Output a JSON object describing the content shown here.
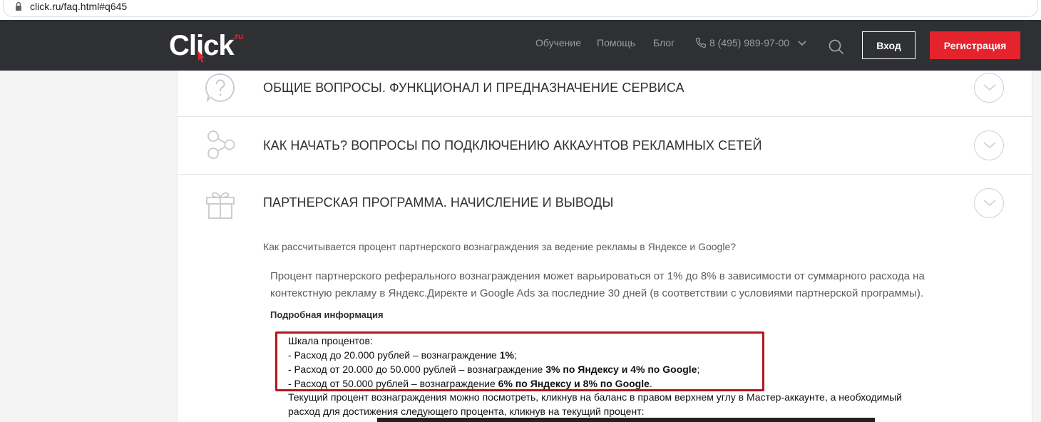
{
  "browser": {
    "url": "click.ru/faq.html#q645"
  },
  "header": {
    "logo_text": "Click",
    "logo_sup": ".ru",
    "nav": [
      "Обучение",
      "Помощь",
      "Блог"
    ],
    "phone": "8 (495) 989-97-00",
    "login_label": "Вход",
    "register_label": "Регистрация",
    "brand_color": "#e4232d"
  },
  "sections": [
    {
      "title": "ОБЩИЕ ВОПРОСЫ. ФУНКЦИОНАЛ И ПРЕДНАЗНАЧЕНИЕ СЕРВИСА",
      "icon": "question-circle-icon"
    },
    {
      "title": "КАК НАЧАТЬ? ВОПРОСЫ ПО ПОДКЛЮЧЕНИЮ АККАУНТОВ РЕКЛАМНЫХ СЕТЕЙ",
      "icon": "nodes-icon"
    },
    {
      "title": "ПАРТНЕРСКАЯ ПРОГРАММА. НАЧИСЛЕНИЕ И ВЫВОДЫ",
      "icon": "gift-icon"
    }
  ],
  "faq": {
    "question": "Как рассчитывается процент партнерского вознаграждения за ведение рекламы в Яндексе и Google?",
    "answer_line1": "Процент партнерского реферального вознаграждения может варьироваться от 1% до 8% в зависимости от суммарного расхода на",
    "answer_line2": "контекстную рекламу в Яндекс.Директе и Google Ads за последние 30 дней (в соответствии с условиями партнерской программы).",
    "more_label": "Подробная информация",
    "scale_title": "Шкала процентов:",
    "scale": [
      {
        "text": "- Расход до 20.000 рублей – вознаграждение ",
        "bold": "1%",
        "end": ";"
      },
      {
        "text": "- Расход от 20.000 до 50.000 рублей – вознаграждение ",
        "bold": "3% по Яндексу и 4% по Google",
        "end": ";"
      },
      {
        "text": "- Расход от 50.000 рублей – вознаграждение ",
        "bold": "6% по Яндексу и 8% по Google",
        "end": "."
      }
    ],
    "footer_line1": "Текущий процент вознаграждения можно посмотреть, кликнув на баланс в правом верхнем углу в Мастер-аккаунте, а необходимый",
    "footer_line2": "расход для достижения следующего процента, кликнув на текущий процент:"
  }
}
